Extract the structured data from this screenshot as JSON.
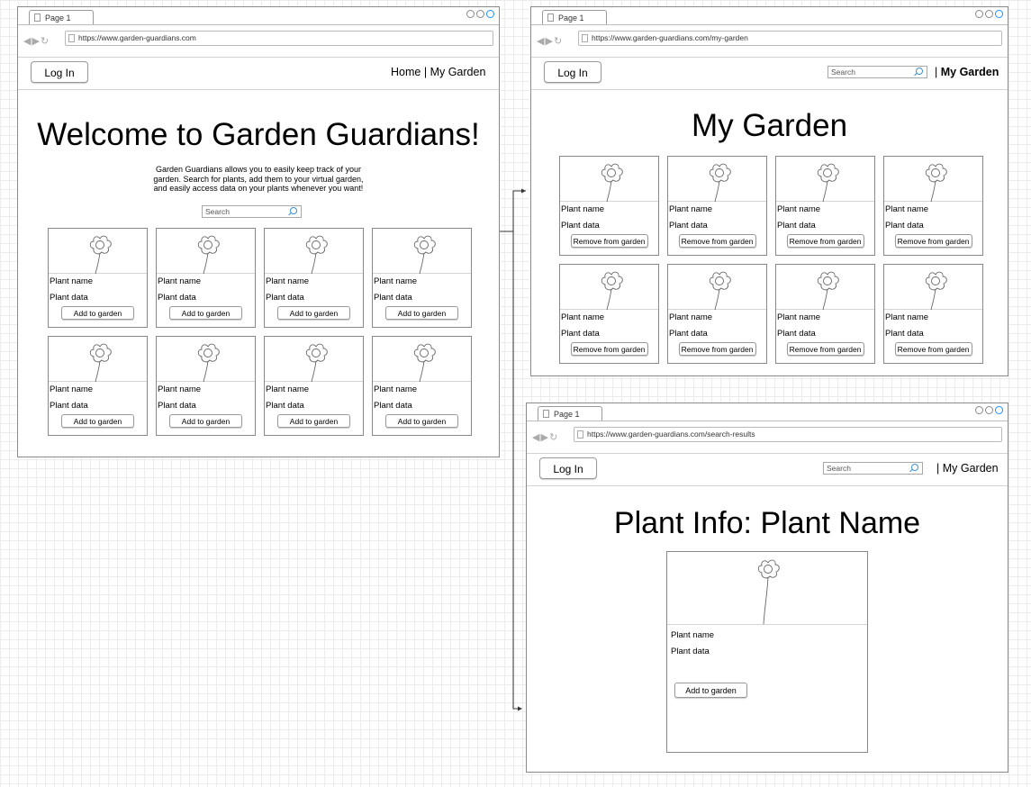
{
  "windows": {
    "home": {
      "tab": "Page 1",
      "url": "https://www.garden-guardians.com",
      "login": "Log In",
      "nav_home": "Home",
      "nav_sep": "|",
      "nav_garden": "My Garden",
      "title": "Welcome to Garden Guardians!",
      "intro_1": "Garden Guardians allows you to easily keep track of your",
      "intro_2": "garden. Search for plants, add them to your virtual garden,",
      "intro_3": "and easily access data on your plants whenever you want!",
      "search_placeholder": "Search",
      "card_name": "Plant name",
      "card_data": "Plant data",
      "card_button": "Add to garden"
    },
    "garden": {
      "tab": "Page 1",
      "url": "https://www.garden-guardians.com/my-garden",
      "login": "Log In",
      "search_placeholder": "Search",
      "nav_sep": "|",
      "nav_garden": "My Garden",
      "title": "My Garden",
      "card_name": "Plant name",
      "card_data": "Plant data",
      "card_button": "Remove from garden"
    },
    "plant": {
      "tab": "Page 1",
      "url": "https://www.garden-guardians.com/search-results",
      "login": "Log In",
      "search_placeholder": "Search",
      "nav_sep": "|",
      "nav_garden": "My Garden",
      "title": "Plant Info: Plant Name",
      "card_name": "Plant name",
      "card_data": "Plant data",
      "card_button": "Add to garden"
    }
  },
  "icons": [
    "page-icon",
    "back-arrow-icon",
    "forward-arrow-icon",
    "reload-icon",
    "window-circle-icon",
    "search-icon",
    "flower-icon"
  ],
  "colors": {
    "window_border": "#8a8a8a",
    "search_icon": "#3a8fd6",
    "active_circle": "#1e90ff"
  }
}
